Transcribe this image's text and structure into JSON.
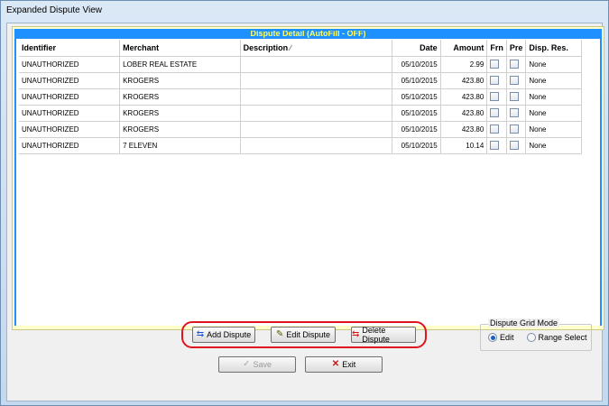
{
  "window": {
    "title": "Expanded Dispute View"
  },
  "grid": {
    "caption": "Dispute Detail (AutoFill - OFF)",
    "columns": [
      "Identifier",
      "Merchant",
      "Description",
      "Date",
      "Amount",
      "Frn",
      "Pre",
      "Disp. Res."
    ],
    "rows": [
      {
        "identifier": "UNAUTHORIZED",
        "merchant": "LOBER REAL ESTATE",
        "description": "",
        "date": "05/10/2015",
        "amount": "2.99",
        "frn": false,
        "pre": false,
        "disp_res": "None"
      },
      {
        "identifier": "UNAUTHORIZED",
        "merchant": "KROGERS",
        "description": "",
        "date": "05/10/2015",
        "amount": "423.80",
        "frn": false,
        "pre": false,
        "disp_res": "None"
      },
      {
        "identifier": "UNAUTHORIZED",
        "merchant": "KROGERS",
        "description": "",
        "date": "05/10/2015",
        "amount": "423.80",
        "frn": false,
        "pre": false,
        "disp_res": "None"
      },
      {
        "identifier": "UNAUTHORIZED",
        "merchant": "KROGERS",
        "description": "",
        "date": "05/10/2015",
        "amount": "423.80",
        "frn": false,
        "pre": false,
        "disp_res": "None"
      },
      {
        "identifier": "UNAUTHORIZED",
        "merchant": "KROGERS",
        "description": "",
        "date": "05/10/2015",
        "amount": "423.80",
        "frn": false,
        "pre": false,
        "disp_res": "None"
      },
      {
        "identifier": "UNAUTHORIZED",
        "merchant": "7 ELEVEN",
        "description": "",
        "date": "05/10/2015",
        "amount": "10.14",
        "frn": false,
        "pre": false,
        "disp_res": "None"
      }
    ]
  },
  "actions": {
    "add_label": "Add Dispute",
    "edit_label": "Edit Dispute",
    "delete_label": "Delete Dispute",
    "save_label": "Save",
    "exit_label": "Exit"
  },
  "grid_mode": {
    "title": "Dispute Grid Mode",
    "options": [
      "Edit",
      "Range Select"
    ],
    "selected": "Edit"
  },
  "icons": {
    "add": "add-rows-icon",
    "edit": "edit-document-icon",
    "delete": "delete-rows-icon",
    "save": "checkmark-icon",
    "exit": "close-x-icon",
    "sort": "sort-indicator-icon"
  },
  "colors": {
    "caption_bg": "#1e90ff",
    "caption_text": "#ffff66",
    "highlight_ring": "#e0141e"
  }
}
